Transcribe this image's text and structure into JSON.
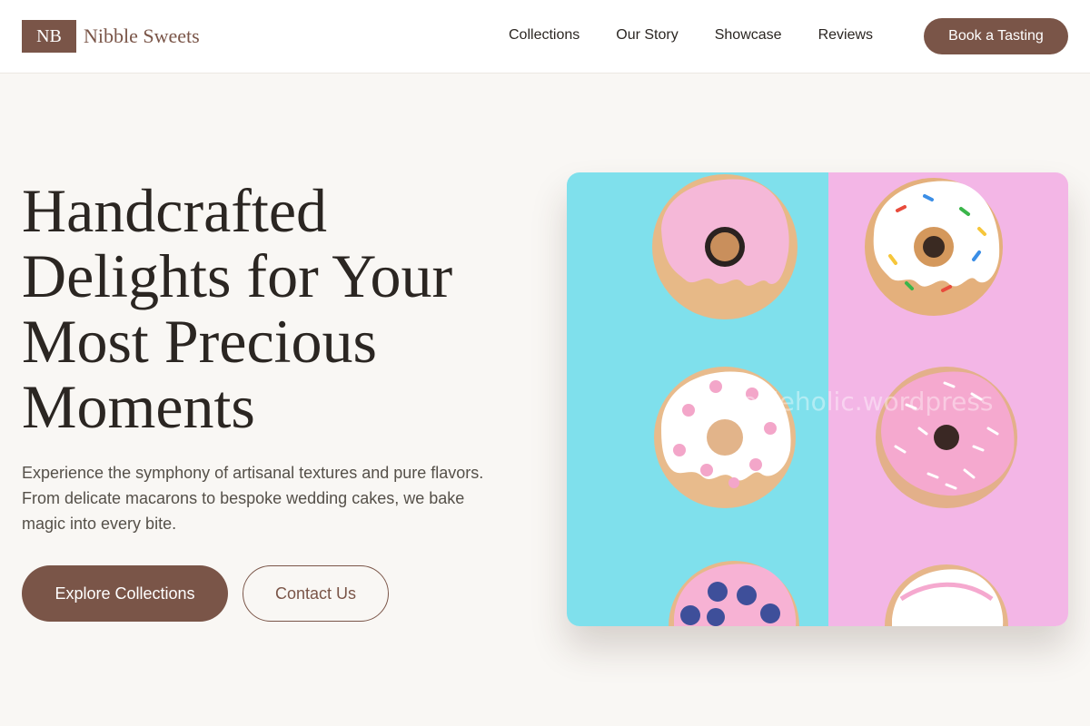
{
  "brand": {
    "monogram": "NB",
    "name": "Nibble Sweets"
  },
  "nav": {
    "links": [
      "Collections",
      "Our Story",
      "Showcase",
      "Reviews"
    ],
    "cta": "Book a Tasting"
  },
  "hero": {
    "title": "Handcrafted Delights for Your Most Precious Moments",
    "subtitle": "Experience the symphony of artisanal textures and pure flavors. From delicate macarons to bespoke wedding cakes, we bake magic into every bite.",
    "primary_button": "Explore Collections",
    "secondary_button": "Contact Us",
    "image": {
      "subject": "six iced donuts on split blue and pink background",
      "watermark": "cookieholic.wordpress",
      "colors": {
        "left_bg": "#7fe0ec",
        "right_bg": "#f3b6e6"
      }
    }
  },
  "colors": {
    "accent": "#7a5548",
    "page_bg": "#f9f7f4",
    "nav_bg": "#ffffff"
  }
}
